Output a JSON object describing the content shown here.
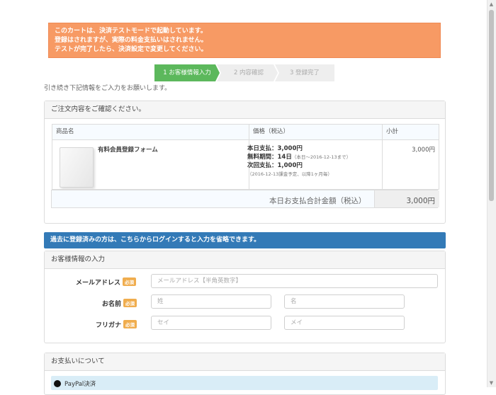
{
  "notice": {
    "line1": "このカートは、決済テストモードで起動しています。",
    "line2": "登録はされますが、実際の料金支払いはされません。",
    "line3": "テストが完了したら、決済設定で変更してください。",
    "bg_color": "#f79a64"
  },
  "steps": [
    {
      "label": "1 お客様情報入力",
      "active": true
    },
    {
      "label": "2 内容確認",
      "active": false
    },
    {
      "label": "3 登録完了",
      "active": false
    }
  ],
  "intro_text": "引き続き下記情報をご入力をお願いします。",
  "order": {
    "heading": "ご注文内容をご確認ください。",
    "columns": [
      "商品名",
      "価格（税込）",
      "小計"
    ],
    "item": {
      "name": "有料会員登録フォーム",
      "image_icon": "product-box-image",
      "price_today": "本日支払：3,000円",
      "free_period": "無料期間：14日",
      "free_period_note": "（本日〜2016-12-13まで）",
      "next_payment": "次回支払：1,000円",
      "next_payment_note": "（2016-12-13課金予定、以降1ヶ月毎）",
      "subtotal": "3,000円"
    },
    "total_label": "本日お支払合計金額（税込）",
    "total_value": "3,000円"
  },
  "login_bar": "過去に登録済みの方は、こちらからログインすると入力を省略できます。",
  "customer": {
    "heading": "お客様情報の入力",
    "required_badge": "必須",
    "email_label": "メールアドレス",
    "email_placeholder": "メールアドレス【半角英数字】",
    "name_label": "お名前",
    "last_name_placeholder": "姓",
    "first_name_placeholder": "名",
    "kana_label": "フリガナ",
    "last_kana_placeholder": "セイ",
    "first_kana_placeholder": "メイ"
  },
  "payment": {
    "heading": "お支払いについて",
    "option_label": "PayPal決済",
    "highlight_color": "#d9edf7"
  },
  "colors": {
    "step_active": "#5cb85c",
    "login_bar": "#337ab7",
    "required_badge": "#f0ad4e"
  }
}
